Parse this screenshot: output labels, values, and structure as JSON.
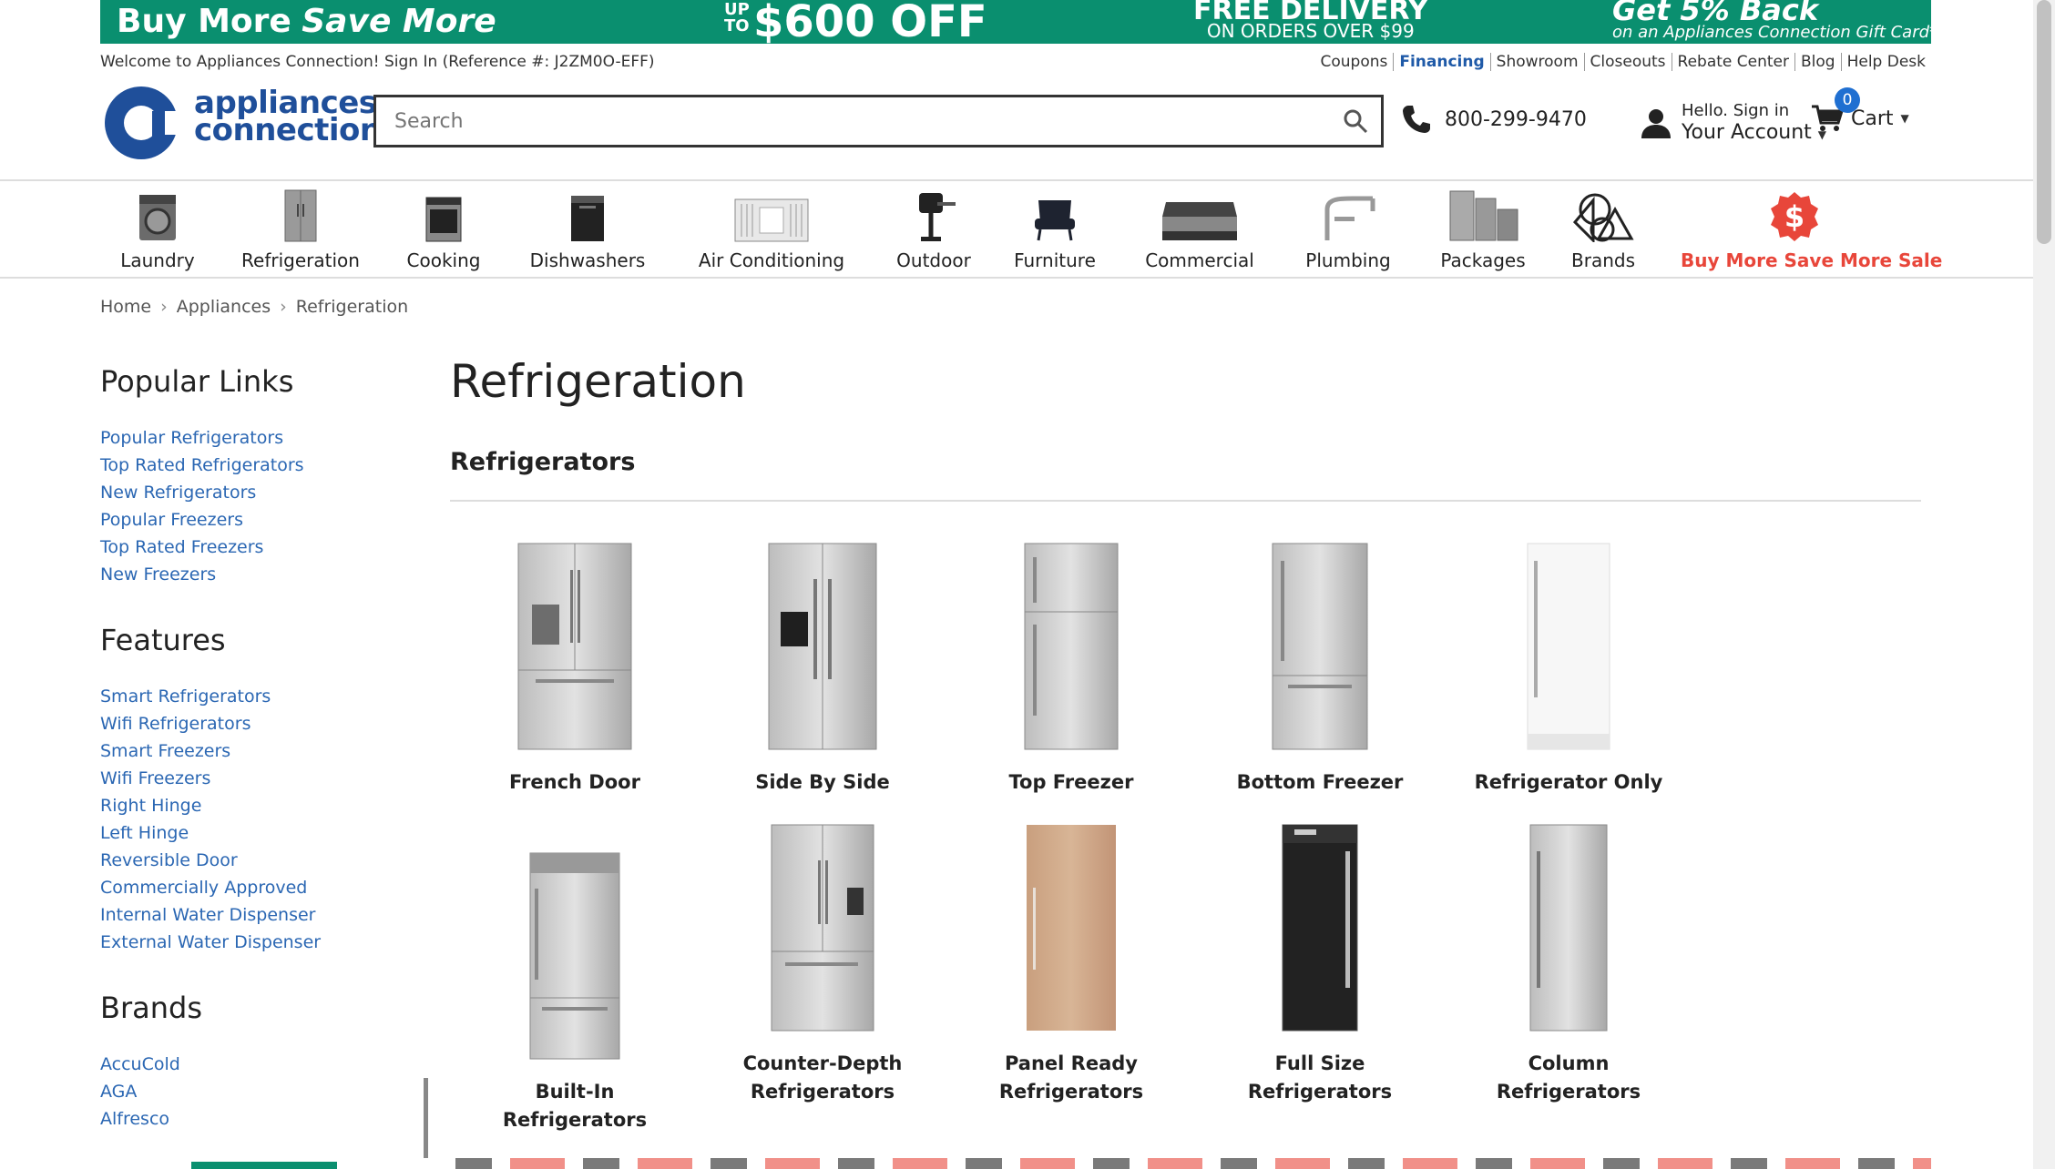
{
  "promo": {
    "left_text": "Buy More",
    "left_script": "Save More",
    "mid_prefix_up": "UP",
    "mid_prefix_to": "TO",
    "mid_text": "$600 OFF",
    "delivery_title": "FREE DELIVERY",
    "delivery_sub": "ON ORDERS OVER $99",
    "cashback_title": "Get 5% Back",
    "cashback_sub": "on an Appliances Connection Gift Card***"
  },
  "utility": {
    "welcome": "Welcome to Appliances Connection! Sign In (Reference #: J2ZM0O-EFF)",
    "links": [
      "Coupons",
      "Financing",
      "Showroom",
      "Closeouts",
      "Rebate Center",
      "Blog",
      "Help Desk"
    ]
  },
  "header": {
    "logo_line1": "appliances",
    "logo_line2": "connection",
    "search_placeholder": "Search",
    "phone": "800-299-9470",
    "account_small": "Hello. Sign in",
    "account_big": "Your Account",
    "cart_label": "Cart",
    "cart_count": "0"
  },
  "colors": {
    "brand_blue": "#1f4f9a",
    "link_blue": "#2b67b3",
    "promo_green": "#0a8f6f",
    "sale_red": "#e8463a",
    "badge_blue": "#1f6fd1"
  },
  "categories": [
    {
      "label": "Laundry",
      "icon": "washer-icon"
    },
    {
      "label": "Refrigeration",
      "icon": "fridge-icon"
    },
    {
      "label": "Cooking",
      "icon": "range-icon"
    },
    {
      "label": "Dishwashers",
      "icon": "dishwasher-icon"
    },
    {
      "label": "Air Conditioning",
      "icon": "ac-icon"
    },
    {
      "label": "Outdoor",
      "icon": "grill-icon"
    },
    {
      "label": "Furniture",
      "icon": "chair-icon"
    },
    {
      "label": "Commercial",
      "icon": "display-case-icon"
    },
    {
      "label": "Plumbing",
      "icon": "faucet-icon"
    },
    {
      "label": "Packages",
      "icon": "package-icon"
    },
    {
      "label": "Brands",
      "icon": "brands-icon"
    },
    {
      "label": "Buy More Save More Sale",
      "icon": "dollar-badge-icon"
    }
  ],
  "breadcrumb": [
    "Home",
    "Appliances",
    "Refrigeration"
  ],
  "sidebar": {
    "popular_title": "Popular Links",
    "popular": [
      "Popular Refrigerators",
      "Top Rated Refrigerators",
      "New Refrigerators",
      "Popular Freezers",
      "Top Rated Freezers",
      "New Freezers"
    ],
    "features_title": "Features",
    "features": [
      "Smart Refrigerators",
      "Wifi Refrigerators",
      "Smart Freezers",
      "Wifi Freezers",
      "Right Hinge",
      "Left Hinge",
      "Reversible Door",
      "Commercially Approved",
      "Internal Water Dispenser",
      "External Water Dispenser"
    ],
    "brands_title": "Brands",
    "brands": [
      "AccuCold",
      "AGA",
      "Alfresco"
    ]
  },
  "main": {
    "title": "Refrigeration",
    "section_title": "Refrigerators",
    "tiles_row1": [
      {
        "label": "French Door",
        "icon": "french-door-fridge-icon"
      },
      {
        "label": "Side By Side",
        "icon": "side-by-side-fridge-icon"
      },
      {
        "label": "Top Freezer",
        "icon": "top-freezer-fridge-icon"
      },
      {
        "label": "Bottom Freezer",
        "icon": "bottom-freezer-fridge-icon"
      },
      {
        "label": "Refrigerator Only",
        "icon": "fridge-only-icon"
      }
    ],
    "tiles_row2": [
      {
        "label": "Built-In Refrigerators",
        "icon": "built-in-fridge-icon"
      },
      {
        "label": "Counter-Depth Refrigerators",
        "icon": "counter-depth-fridge-icon"
      },
      {
        "label": "Panel Ready Refrigerators",
        "icon": "panel-ready-fridge-icon"
      },
      {
        "label": "Full Size Refrigerators",
        "icon": "full-size-fridge-icon"
      },
      {
        "label": "Column Refrigerators",
        "icon": "column-fridge-icon"
      }
    ]
  }
}
